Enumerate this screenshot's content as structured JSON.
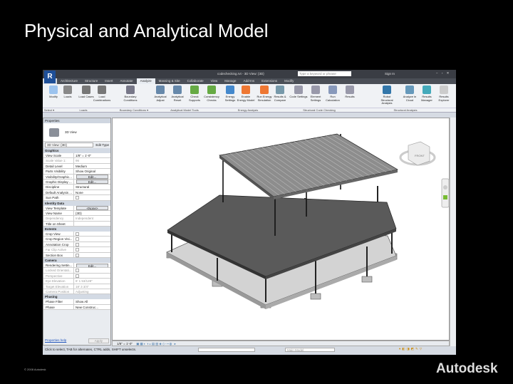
{
  "slide": {
    "title": "Physical and Analytical Model",
    "copyright": "© 2008 Autodesk",
    "logo": "Autodesk"
  },
  "app": {
    "logo_letter": "R",
    "window_title": "codechecking.rvt - 3D View: {3D}",
    "search_placeholder": "Type a keyword or phrase",
    "sign_in": "Sign In",
    "window_controls": "– ▫ ✕"
  },
  "tabs": [
    {
      "label": "Architecture"
    },
    {
      "label": "Structure"
    },
    {
      "label": "Insert"
    },
    {
      "label": "Annotate"
    },
    {
      "label": "Analyze",
      "active": true
    },
    {
      "label": "Massing & Site"
    },
    {
      "label": "Collaborate"
    },
    {
      "label": "View"
    },
    {
      "label": "Manage"
    },
    {
      "label": "Add-Ins"
    },
    {
      "label": "Extensions"
    },
    {
      "label": "Modify"
    }
  ],
  "tools": [
    {
      "label": "Modify"
    },
    {
      "label": "Loads"
    },
    {
      "label": "Load Cases"
    },
    {
      "label": "Load Combinations"
    },
    {
      "label": "Boundary Conditions"
    },
    {
      "label": "Analytical Adjust"
    },
    {
      "label": "Analytical Reset"
    },
    {
      "label": "Check Supports"
    },
    {
      "label": "Consistency Checks"
    },
    {
      "label": "Energy Settings"
    },
    {
      "label": "Enable Energy Model"
    },
    {
      "label": "Run Energy Simulation"
    },
    {
      "label": "Results & Compare"
    },
    {
      "label": "Code Settings"
    },
    {
      "label": "Element Settings"
    },
    {
      "label": "Run Calculation"
    },
    {
      "label": "Results"
    },
    {
      "label": "Robot Structural Analysis"
    },
    {
      "label": "Analyze in Cloud"
    },
    {
      "label": "Results Manager"
    },
    {
      "label": "Results Explorer"
    }
  ],
  "panels": [
    "Select ▾",
    "Loads",
    "Boundary Conditions ▾",
    "Analytical Model Tools",
    "Energy Analysis",
    "Structural Code Checking",
    "Structural Analysis"
  ],
  "properties": {
    "title": "Properties",
    "type_name": "3D View",
    "selector": "3D View: {3D}",
    "edit_type": "Edit Type",
    "help": "Properties help",
    "apply": "Apply",
    "groups": [
      {
        "name": "Graphics",
        "rows": [
          [
            "View Scale",
            "1/8\" = 1'-0\""
          ],
          [
            "Scale Value 1:",
            "96"
          ],
          [
            "Detail Level",
            "Medium"
          ],
          [
            "Parts Visibility",
            "Show Original"
          ],
          [
            "Visibility/Graphic...",
            "Edit..."
          ],
          [
            "Graphic Display ...",
            "Edit..."
          ],
          [
            "Discipline",
            "Structural"
          ],
          [
            "Default Analysis ...",
            "None"
          ],
          [
            "Sun Path",
            ""
          ]
        ]
      },
      {
        "name": "Identity Data",
        "rows": [
          [
            "View Template",
            "<None>"
          ],
          [
            "View Name",
            "{3D}"
          ],
          [
            "Dependency",
            "Independent"
          ],
          [
            "Title on Sheet",
            ""
          ]
        ]
      },
      {
        "name": "Extents",
        "rows": [
          [
            "Crop View",
            ""
          ],
          [
            "Crop Region Visi...",
            ""
          ],
          [
            "Annotation Crop",
            ""
          ],
          [
            "Far Clip Active",
            ""
          ],
          [
            "Section Box",
            ""
          ]
        ]
      },
      {
        "name": "Camera",
        "rows": [
          [
            "Rendering Settin...",
            "Edit..."
          ],
          [
            "Locked Orientati...",
            ""
          ],
          [
            "Perspective",
            ""
          ],
          [
            "Eye Elevation",
            "6'  1 53/128\""
          ],
          [
            "Target Elevation",
            "18'  3 3/4\""
          ],
          [
            "Camera Position",
            "Adjusting"
          ]
        ]
      },
      {
        "name": "Phasing",
        "rows": [
          [
            "Phase Filter",
            "Show All"
          ],
          [
            "Phase",
            "New Construc..."
          ]
        ]
      }
    ]
  },
  "viewcube": {
    "face": "FRONT"
  },
  "view_control": {
    "scale": "1/8\" = 1'-0\""
  },
  "status": {
    "text": "Click to select, TAB for alternates, CTRL adds, SHIFT unselects.",
    "model": "Main Model"
  }
}
